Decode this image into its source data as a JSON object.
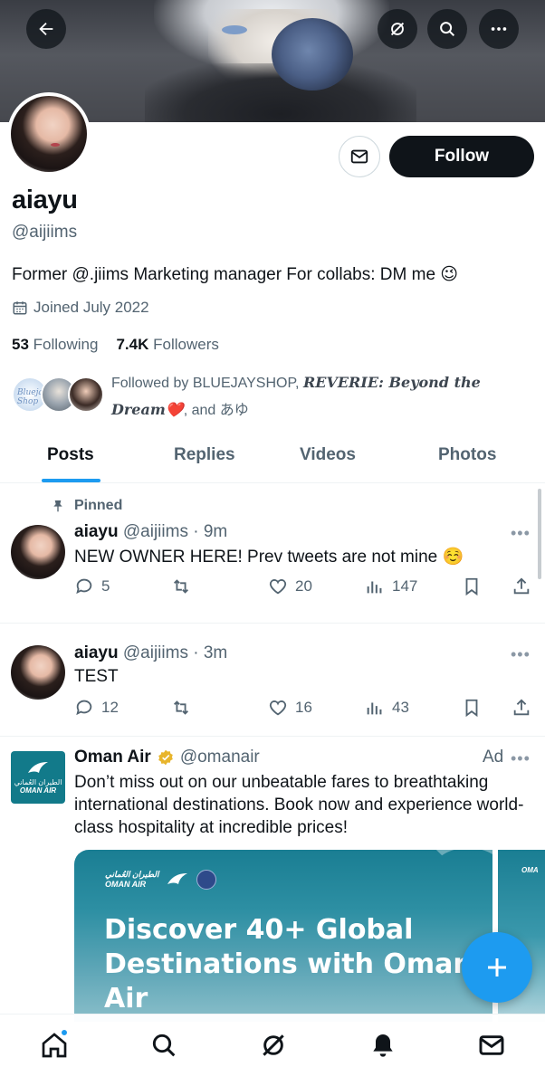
{
  "colors": {
    "accent": "#1d9bf0",
    "text": "#0f1419",
    "muted": "#536471",
    "oman_teal": "#127a8a"
  },
  "header_icons": [
    "back-arrow-icon",
    "grok-icon",
    "search-icon",
    "more-icon"
  ],
  "profile": {
    "name": "aiayu",
    "handle": "@aijiims",
    "follow_label": "Follow",
    "bio": "Former @.jiims Marketing manager For collabs: DM me 😉",
    "joined": "Joined July 2022",
    "following_count": "53",
    "following_label": "Following",
    "followers_count": "7.4K",
    "followers_label": "Followers",
    "followed_by_prefix": "Followed by BLUEJAYSHOP, ",
    "followed_by_fancy_a": "REVERIE: Beyond the",
    "followed_by_fancy_b": "Dream❤️",
    "followed_by_suffix": ", and あゆ",
    "followed_avatar_1_text": "Bluejay Shop"
  },
  "tabs": [
    {
      "label": "Posts",
      "active": true
    },
    {
      "label": "Replies",
      "active": false
    },
    {
      "label": "Videos",
      "active": false
    },
    {
      "label": "Photos",
      "active": false
    }
  ],
  "tweets": [
    {
      "pinned_label": "Pinned",
      "name": "aiayu",
      "meta": "@aijiims · 9m",
      "text": "NEW OWNER HERE! Prev tweets are not mine ☺️",
      "replies": "5",
      "retweets": "",
      "likes": "20",
      "views": "147"
    },
    {
      "name": "aiayu",
      "meta": "@aijiims · 3m",
      "text": "TEST",
      "replies": "12",
      "retweets": "",
      "likes": "16",
      "views": "43"
    }
  ],
  "ad": {
    "name": "Oman Air",
    "handle": "@omanair",
    "label": "Ad",
    "text": "Don’t miss out on our unbeatable fares to breathtaking international destinations. Book now and experience world-class hospitality at incredible prices!",
    "logo_ar": "الطيران العُماني",
    "logo_en": "OMAN AIR",
    "card_brand_ar": "الطيران العُماني",
    "card_brand_en": "OMAN AIR",
    "card_headline": "Discover 40+ Global Destinations with Oman Air",
    "card2_brand": "OMA"
  },
  "fab_icon": "plus-icon",
  "bottom_nav": [
    "home-icon",
    "search-icon",
    "grok-icon",
    "notifications-icon",
    "messages-icon"
  ]
}
